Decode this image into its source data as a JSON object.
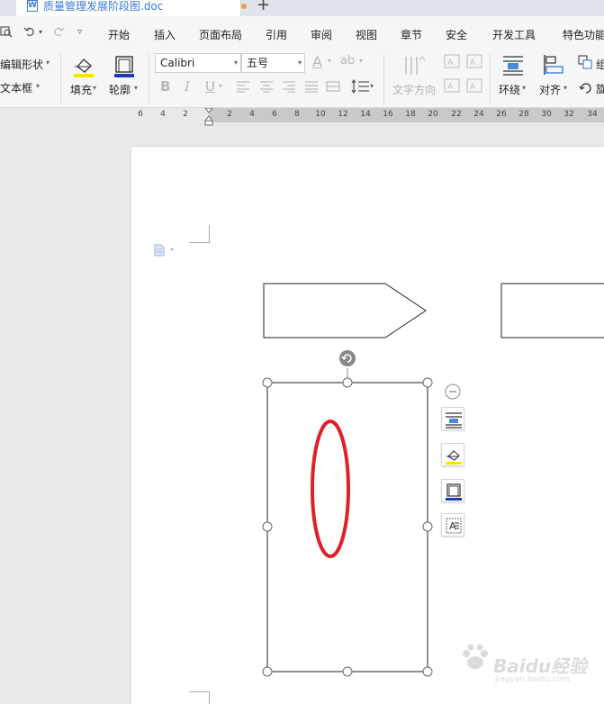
{
  "tab": {
    "doc_icon_letter": "W",
    "title": "质量管理发展阶段图.doc",
    "new_tab": "+"
  },
  "menu": {
    "items": [
      "开始",
      "插入",
      "页面布局",
      "引用",
      "审阅",
      "视图",
      "章节",
      "安全",
      "开发工具",
      "特色功能"
    ]
  },
  "ribbon": {
    "edit_shape": "编辑形状",
    "text_box": "文本框",
    "fill": "填充",
    "outline": "轮廓",
    "font_name": "Calibri",
    "font_size": "五号",
    "text_direction": "文字方向",
    "wrap": "环绕",
    "align": "对齐",
    "group": "组",
    "rotate": "旋",
    "bold": "B",
    "italic": "I",
    "underline": "U",
    "font_color_glyph": "A",
    "highlight_glyph": "ab"
  },
  "ruler": {
    "ticks": [
      "6",
      "4",
      "2",
      "2",
      "4",
      "6",
      "8",
      "10",
      "12",
      "14",
      "16",
      "18",
      "20",
      "22",
      "24",
      "26",
      "28",
      "30",
      "32",
      "34"
    ]
  },
  "watermark": {
    "logo_text": "Baidu经验",
    "sub_text": "jingyan.baidu.com"
  },
  "colors": {
    "accent": "#3a7bd5",
    "ellipse": "#e02029",
    "fill_yellow": "#f5e500",
    "outline_blue": "#1e3bb3"
  }
}
